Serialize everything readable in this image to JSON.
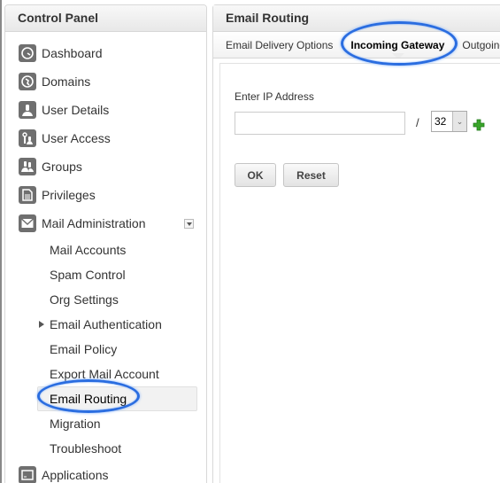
{
  "sidebar": {
    "title": "Control Panel",
    "items": [
      {
        "label": "Dashboard",
        "icon": "dashboard-icon"
      },
      {
        "label": "Domains",
        "icon": "globe-icon"
      },
      {
        "label": "User Details",
        "icon": "user-icon"
      },
      {
        "label": "User Access",
        "icon": "user-access-icon"
      },
      {
        "label": "Groups",
        "icon": "groups-icon"
      },
      {
        "label": "Privileges",
        "icon": "document-icon"
      },
      {
        "label": "Mail Administration",
        "icon": "envelope-icon",
        "expanded": true
      },
      {
        "label": "Applications",
        "icon": "applications-icon"
      }
    ],
    "mail_admin_sub": [
      {
        "label": "Mail Accounts"
      },
      {
        "label": "Spam Control"
      },
      {
        "label": "Org Settings"
      },
      {
        "label": "Email Authentication",
        "has_children": true
      },
      {
        "label": "Email Policy"
      },
      {
        "label": "Export Mail Account"
      },
      {
        "label": "Email Routing",
        "active": true
      },
      {
        "label": "Migration"
      },
      {
        "label": "Troubleshoot"
      }
    ]
  },
  "main": {
    "title": "Email Routing",
    "tabs": [
      {
        "label": "Email Delivery Options"
      },
      {
        "label": "Incoming Gateway",
        "active": true
      },
      {
        "label": "Outgoing"
      }
    ],
    "form": {
      "ip_label": "Enter IP Address",
      "ip_value": "",
      "slash": "/",
      "cidr_value": "32",
      "ok_label": "OK",
      "reset_label": "Reset"
    }
  },
  "colors": {
    "annotation": "#2a6de0",
    "add_icon": "#3aa52a"
  }
}
